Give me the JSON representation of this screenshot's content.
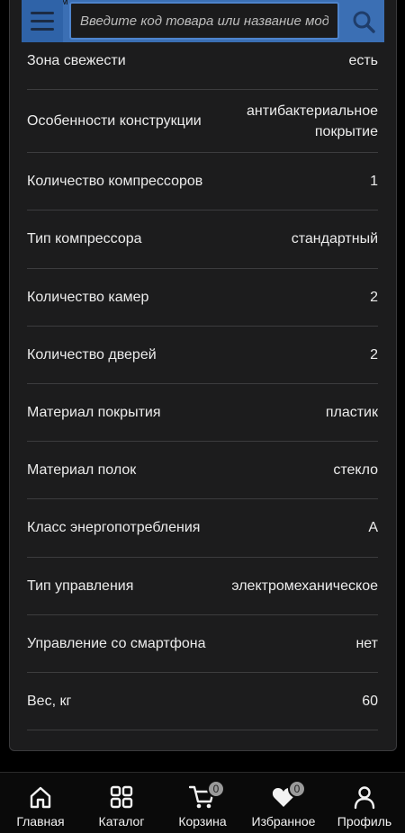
{
  "header": {
    "search_placeholder": "Введите код товара или название модели",
    "mini_text": "м"
  },
  "specs": [
    {
      "label": "Зона свежести",
      "value": "есть"
    },
    {
      "label": "Особенности конструкции",
      "value": "антибактериальное покрытие"
    },
    {
      "label": "Количество компрессоров",
      "value": "1"
    },
    {
      "label": "Тип компрессора",
      "value": "стандартный"
    },
    {
      "label": "Количество камер",
      "value": "2"
    },
    {
      "label": "Количество дверей",
      "value": "2"
    },
    {
      "label": "Материал покрытия",
      "value": "пластик"
    },
    {
      "label": "Материал полок",
      "value": "стекло"
    },
    {
      "label": "Класс энергопотребления",
      "value": "A"
    },
    {
      "label": "Тип управления",
      "value": "электромеханическое"
    },
    {
      "label": "Управление со смартфона",
      "value": "нет"
    },
    {
      "label": "Вес, кг",
      "value": "60"
    }
  ],
  "bottom_nav": {
    "home": "Главная",
    "catalog": "Каталог",
    "cart": "Корзина",
    "cart_count": "0",
    "favorites": "Избранное",
    "favorites_count": "0",
    "profile": "Профиль"
  },
  "colors": {
    "accent": "#3b6fb4",
    "background": "#000000",
    "panel": "#1c1c1d"
  }
}
